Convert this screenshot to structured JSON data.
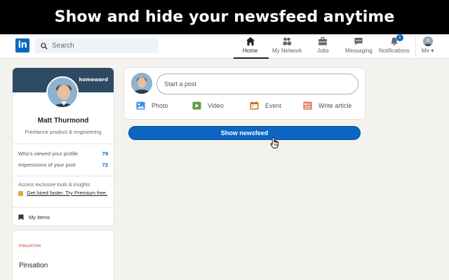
{
  "banner": {
    "text": "Show and hide your newsfeed anytime"
  },
  "nav": {
    "logo": "in",
    "search_placeholder": "Search",
    "items": [
      {
        "label": "Home",
        "icon": "home-icon",
        "active": true
      },
      {
        "label": "My Network",
        "icon": "network-icon"
      },
      {
        "label": "Jobs",
        "icon": "briefcase-icon"
      },
      {
        "label": "Messaging",
        "icon": "message-icon"
      },
      {
        "label": "Notifications",
        "icon": "bell-icon",
        "badge": "1"
      },
      {
        "label": "Me",
        "icon": "avatar"
      }
    ]
  },
  "profile": {
    "cover_brand": "homeward",
    "name": "Matt Thurmond",
    "headline": "Freelance product & engineering",
    "stats": [
      {
        "label": "Who's viewed your profile",
        "value": "79"
      },
      {
        "label": "Impressions of your post",
        "value": "72"
      }
    ],
    "premium_text": "Access exclusive tools & insights",
    "premium_link": "Get hired faster. Try Premium free.",
    "my_items": "My items"
  },
  "pinsation": {
    "logo": "PINSATION",
    "name": "Pinsation"
  },
  "post": {
    "placeholder": "Start a post",
    "actions": [
      {
        "label": "Photo",
        "icon": "photo-icon",
        "color": "#378fe9"
      },
      {
        "label": "Video",
        "icon": "video-icon",
        "color": "#5f9b41"
      },
      {
        "label": "Event",
        "icon": "event-icon",
        "color": "#c37d16"
      },
      {
        "label": "Write article",
        "icon": "article-icon",
        "color": "#e06847"
      }
    ]
  },
  "show_newsfeed": "Show newsfeed",
  "colors": {
    "brand": "#0a66c2",
    "background": "#f3f2ef",
    "banner": "#000000"
  }
}
